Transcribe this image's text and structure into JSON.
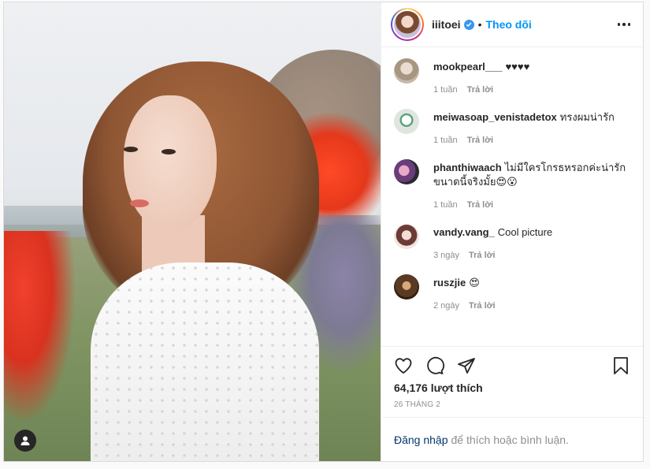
{
  "post": {
    "author": {
      "username": "iiitoei",
      "follow_label": "Theo dõi",
      "separator": "•"
    },
    "comments": [
      {
        "username": "mookpearl___",
        "text": "♥♥♥♥",
        "time": "1 tuần",
        "reply_label": "Trả lời",
        "avatar_color": "#b9a99a"
      },
      {
        "username": "meiwasoap_venistadetox",
        "text": "ทรงผมน่ารัก",
        "time": "1 tuần",
        "reply_label": "Trả lời",
        "avatar_color": "#cfd8cf"
      },
      {
        "username": "phanthiwaach",
        "text": "ไม่มีใครโกรธหรอกค่ะน่ารักขนาดนี้จริงมั้ย😍😮",
        "time": "1 tuần",
        "reply_label": "Trả lời",
        "avatar_color": "#7c5b86"
      },
      {
        "username": "vandy.vang_",
        "text": "Cool picture",
        "time": "3 ngày",
        "reply_label": "Trả lời",
        "avatar_color": "#e7c9c2"
      },
      {
        "username": "ruszjie",
        "text": "😍",
        "time": "2 ngày",
        "reply_label": "Trả lời",
        "avatar_color": "#5a3a22"
      }
    ],
    "likes": "64,176 lượt thích",
    "date": "26 THÁNG 2",
    "login_prompt": {
      "link": "Đăng nhập",
      "rest": "để thích hoặc bình luận."
    }
  },
  "colors": {
    "link_blue": "#0095f6",
    "verified_blue": "#3897f0",
    "muted": "#8e8e8e"
  },
  "icons": [
    "user-tag-icon",
    "verified-icon",
    "more-options-icon",
    "heart-icon",
    "comment-icon",
    "share-icon",
    "bookmark-icon"
  ]
}
